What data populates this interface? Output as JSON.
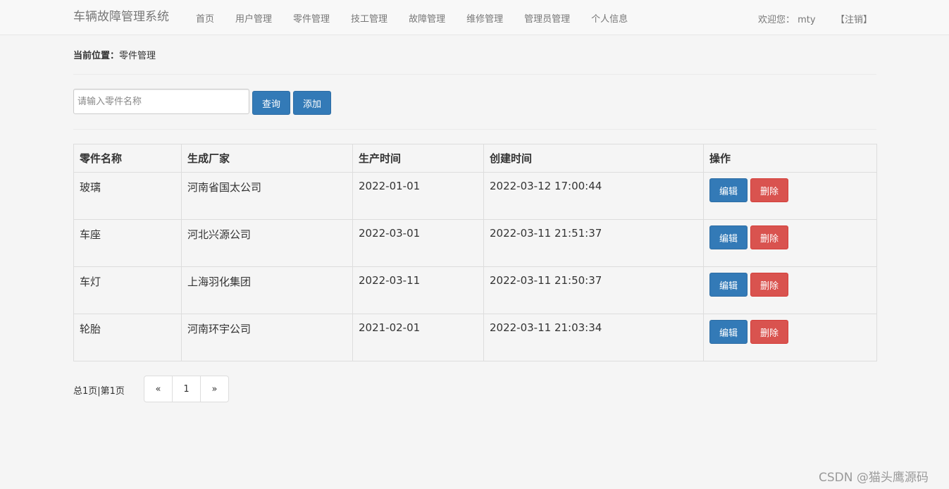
{
  "navbar": {
    "brand": "车辆故障管理系统",
    "items": [
      {
        "label": "首页"
      },
      {
        "label": "用户管理"
      },
      {
        "label": "零件管理"
      },
      {
        "label": "技工管理"
      },
      {
        "label": "故障管理"
      },
      {
        "label": "维修管理"
      },
      {
        "label": "管理员管理"
      },
      {
        "label": "个人信息"
      }
    ],
    "welcome": "欢迎您： mty",
    "logout": "【注销】"
  },
  "breadcrumb": {
    "label": "当前位置：",
    "current": "零件管理"
  },
  "search": {
    "placeholder": "请输入零件名称",
    "value": "",
    "query_label": "查询",
    "add_label": "添加"
  },
  "table": {
    "headers": [
      "零件名称",
      "生成厂家",
      "生产时间",
      "创建时间",
      "操作"
    ],
    "rows": [
      {
        "name": "玻璃",
        "maker": "河南省国太公司",
        "prod_date": "2022-01-01",
        "created": "2022-03-12 17:00:44"
      },
      {
        "name": "车座",
        "maker": "河北兴源公司",
        "prod_date": "2022-03-01",
        "created": "2022-03-11 21:51:37"
      },
      {
        "name": "车灯",
        "maker": "上海羽化集团",
        "prod_date": "2022-03-11",
        "created": "2022-03-11 21:50:37"
      },
      {
        "name": "轮胎",
        "maker": "河南环宇公司",
        "prod_date": "2021-02-01",
        "created": "2022-03-11 21:03:34"
      }
    ],
    "edit_label": "编辑",
    "delete_label": "删除"
  },
  "pagination": {
    "summary": "总1页|第1页",
    "prev": "«",
    "current": "1",
    "next": "»"
  },
  "watermark": "CSDN @猫头鹰源码",
  "colors": {
    "primary": "#337ab7",
    "danger": "#d9534f",
    "background": "#f5f5f5"
  }
}
